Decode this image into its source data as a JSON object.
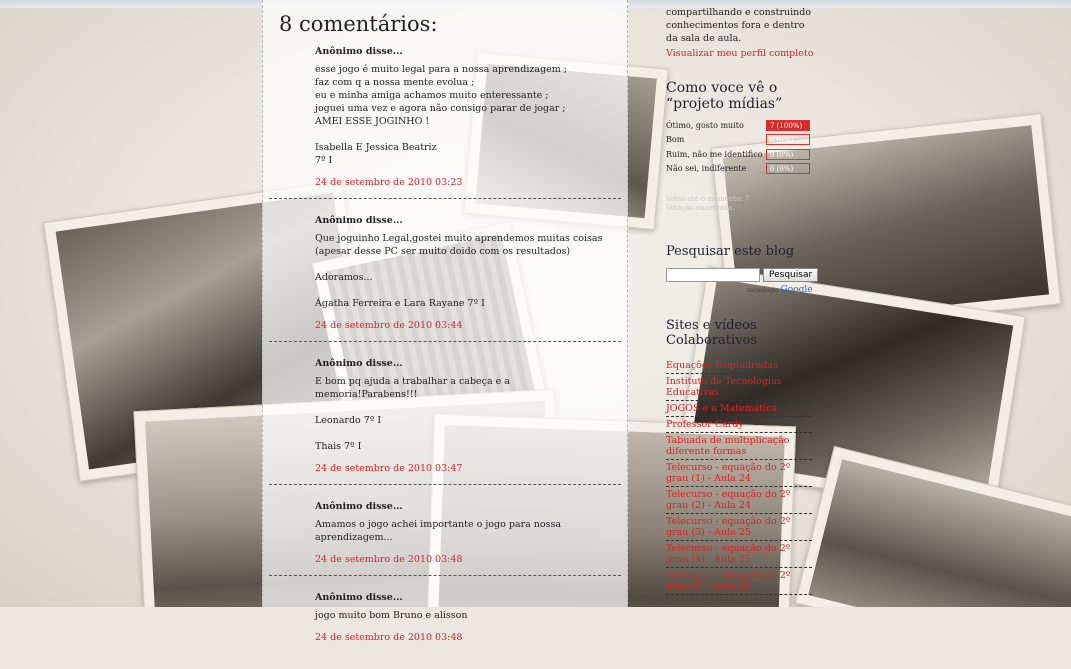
{
  "page": {
    "comments_heading": "8 comentários:"
  },
  "comments": [
    {
      "author": "Anônimo disse...",
      "body": "esse jogo é muito legal para a nossa aprendizagem ;\nfaz com q a nossa mente evolua ;\neu e minha amiga achamos muito enteressante ;\njoguei uma vez e agora não consigo parar de jogar ;\nAMEI ESSE JOGINHO !\n\nIsabella E Jessica Beatriz\n7º I",
      "date": "24 de setembro de 2010 03:23"
    },
    {
      "author": "Anônimo disse...",
      "body": "Que joguinho Legal,gostei muito aprendemos muitas coisas (apesar desse PC ser muito doido com os resultados)\n\nAdoramos...\n\nÁgatha Ferreira e Lara Rayane 7º I",
      "date": "24 de setembro de 2010 03:44"
    },
    {
      "author": "Anônimo disse...",
      "body": "E bom pq ajuda a trabalhar a cabeça e a memoria!Parabens!!!\n\nLeonardo 7º I\n\nThais 7º I",
      "date": "24 de setembro de 2010 03:47"
    },
    {
      "author": "Anônimo disse...",
      "body": "Amamos o jogo achei importante o jogo para nossa aprendizagem...",
      "date": "24 de setembro de 2010 03:48"
    },
    {
      "author": "Anônimo disse...",
      "body": "jogo muito bom Bruno e alisson",
      "date": "24 de setembro de 2010 03:48"
    }
  ],
  "sidebar": {
    "profile_text": "compartilhando e construindo conhecimentos fora e dentro da sala de aula.",
    "profile_link": "Visualizar meu perfil completo",
    "poll": {
      "title": "Como voce vê o “projeto mídias”",
      "options": [
        {
          "label": "Ótimo, gosto muito",
          "result": "7 (100%)",
          "fraction": 1.0
        },
        {
          "label": "Bom",
          "result": "0 (0%)",
          "fraction": 0.0
        },
        {
          "label": "Ruim, não me identifico",
          "result": "0 (0%)",
          "fraction": 0.0
        },
        {
          "label": "Não sei, indiferente",
          "result": "0 (0%)",
          "fraction": 0.0
        }
      ],
      "votes_note": "Votos até o momento: 7",
      "closed_note": "Votação encerrada"
    },
    "search": {
      "title": "Pesquisar este blog",
      "input_value": "",
      "button_label": "Pesquisar",
      "powered_by": "tecnologia",
      "google": "Google"
    },
    "sites": {
      "title": "Sites e vídeos Colaborativos",
      "links": [
        "Equações Esquadradas",
        "Instituto de Tecnologias Educativas",
        "JOGOS e a Matemática",
        "Professor Cardy",
        "Tabuada de multiplicação diferente formas",
        "Telecurso - equação do 2º grau (1) - Aula 24",
        "Telecurso - equação do 2º grau (2) - Aula 24",
        "Telecurso - equação do 2º grau (3) - Aula 25",
        "Telecurso - equação do 2º grau (4) - Aula 25",
        "Telecurso - equação do 2º grau (5) - Aula 26"
      ]
    }
  },
  "colors": {
    "link": "#dd2222",
    "poll_bar": "#d82a2a"
  }
}
